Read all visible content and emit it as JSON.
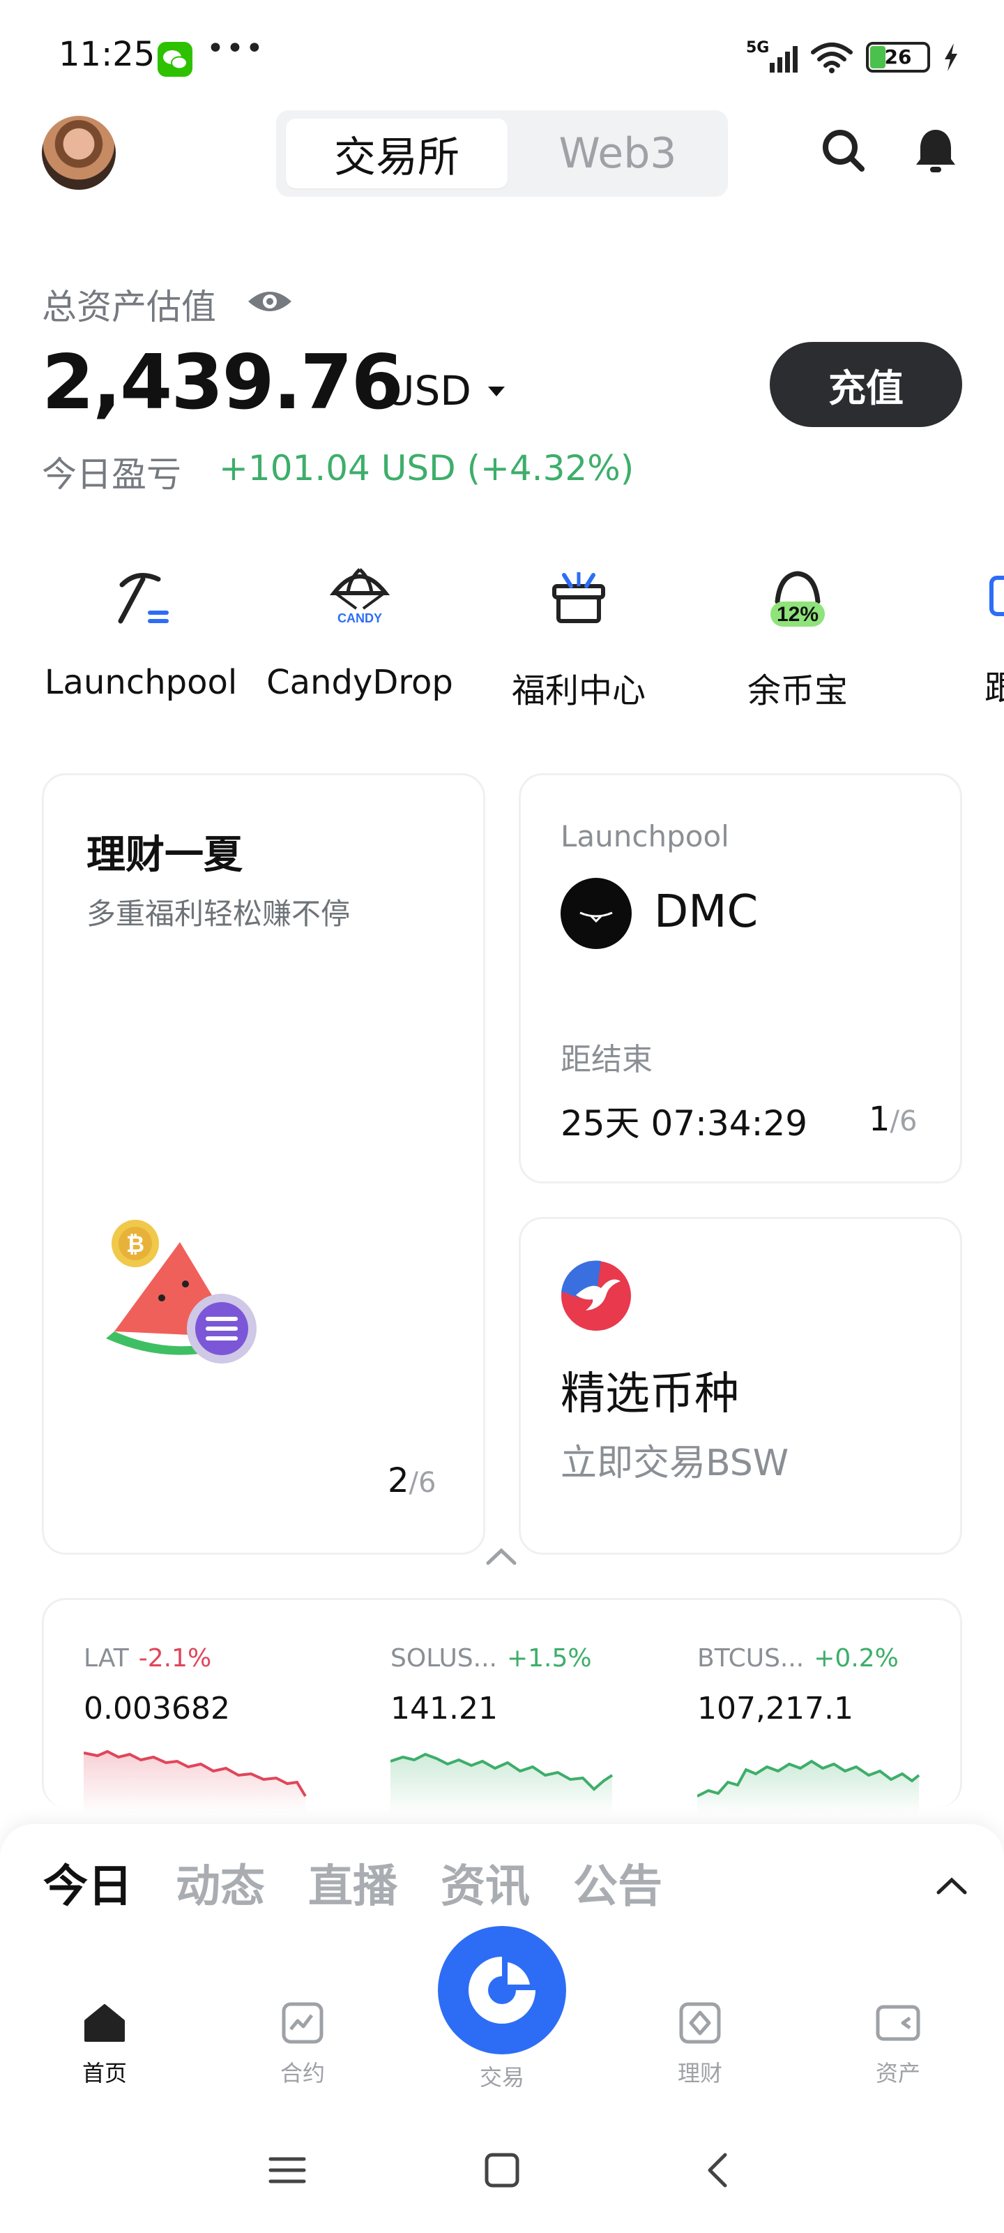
{
  "status_bar": {
    "time": "11:25",
    "dots": "•••",
    "network": "5G",
    "battery": "26"
  },
  "header": {
    "tabs": [
      {
        "label": "交易所",
        "active": true
      },
      {
        "label": "Web3",
        "active": false
      }
    ],
    "icons": [
      "avatar",
      "search-icon",
      "bell-icon"
    ]
  },
  "assets": {
    "label": "总资产估值",
    "value": "2,439.76",
    "currency": "USD",
    "deposit_label": "充值",
    "pnl_label": "今日盈亏",
    "pnl_value": "+101.04 USD  (+4.32%)"
  },
  "quick_nav": [
    {
      "label": "Launchpool",
      "icon": "pickaxe-icon"
    },
    {
      "label": "CandyDrop",
      "icon": "candy-parachute-icon"
    },
    {
      "label": "福利中心",
      "icon": "gift-icon"
    },
    {
      "label": "余币宝",
      "icon": "savings-icon",
      "badge": "12%"
    },
    {
      "label": "跟",
      "icon": "copy-trade-icon"
    }
  ],
  "promo_card": {
    "title": "理财一夏",
    "subtitle": "多重福利轻松赚不停",
    "page": "2",
    "total": "/6"
  },
  "launchpool_card": {
    "label": "Launchpool",
    "token": "DMC",
    "end_label": "距结束",
    "countdown": "25天 07:34:29",
    "page": "1",
    "total": "/6"
  },
  "featured_card": {
    "title": "精选币种",
    "subtitle": "立即交易BSW"
  },
  "tickers": [
    {
      "name": "LAT",
      "change": "-2.1%",
      "price": "0.003682",
      "direction": "down"
    },
    {
      "name": "SOLUS...",
      "change": "+1.5%",
      "price": "141.21",
      "direction": "up"
    },
    {
      "name": "BTCUS...",
      "change": "+0.2%",
      "price": "107,217.1",
      "direction": "up"
    }
  ],
  "feed_tabs": [
    {
      "label": "今日",
      "active": true
    },
    {
      "label": "动态",
      "active": false
    },
    {
      "label": "直播",
      "active": false
    },
    {
      "label": "资讯",
      "active": false
    },
    {
      "label": "公告",
      "active": false
    }
  ],
  "tabbar": [
    {
      "label": "首页",
      "icon": "home-icon",
      "active": true
    },
    {
      "label": "合约",
      "icon": "futures-chart-icon",
      "active": false
    },
    {
      "label": "交易",
      "icon": "trade-icon",
      "active": false
    },
    {
      "label": "理财",
      "icon": "earn-icon",
      "active": false
    },
    {
      "label": "资产",
      "icon": "wallet-icon",
      "active": false
    }
  ],
  "colors": {
    "up": "#3dae6a",
    "down": "#e0465a",
    "brand": "#2d6df6",
    "dark_button": "#2b2d31"
  }
}
